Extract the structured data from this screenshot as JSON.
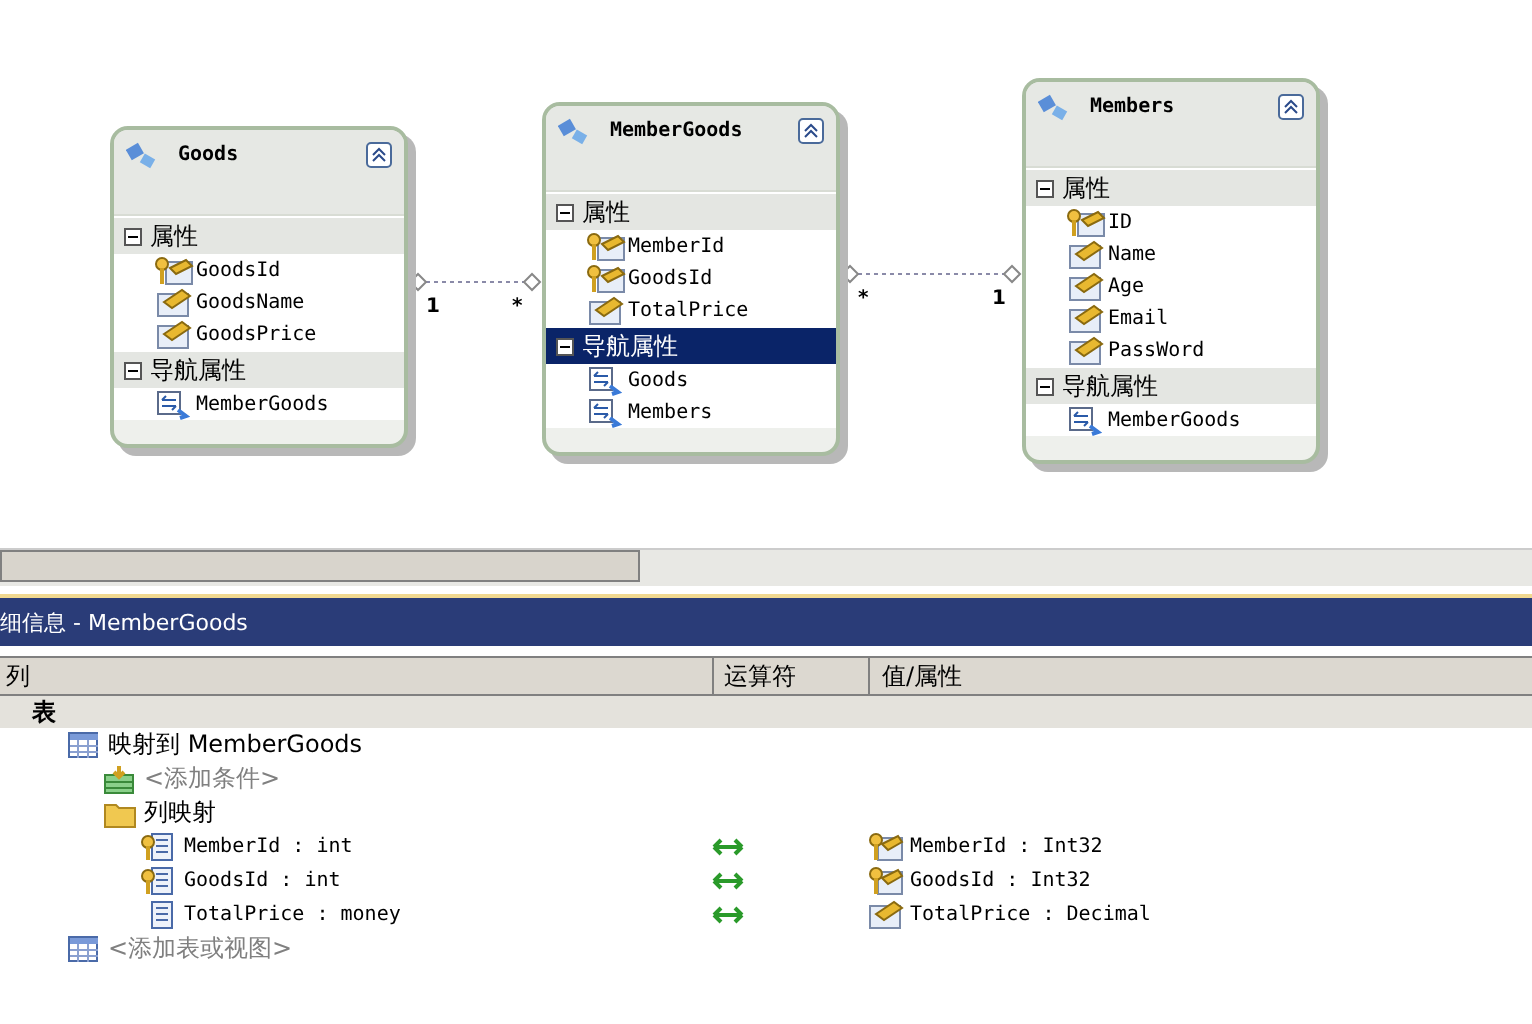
{
  "entities": [
    {
      "name": "Goods",
      "sections": [
        {
          "label": "属性",
          "expanded": true,
          "selected": false,
          "items": [
            {
              "name": "GoodsId",
              "kind": "key"
            },
            {
              "name": "GoodsName",
              "kind": "property"
            },
            {
              "name": "GoodsPrice",
              "kind": "property"
            }
          ]
        },
        {
          "label": "导航属性",
          "expanded": true,
          "selected": false,
          "items": [
            {
              "name": "MemberGoods",
              "kind": "navigation"
            }
          ]
        }
      ]
    },
    {
      "name": "MemberGoods",
      "sections": [
        {
          "label": "属性",
          "expanded": true,
          "selected": false,
          "items": [
            {
              "name": "MemberId",
              "kind": "key"
            },
            {
              "name": "GoodsId",
              "kind": "key"
            },
            {
              "name": "TotalPrice",
              "kind": "property"
            }
          ]
        },
        {
          "label": "导航属性",
          "expanded": true,
          "selected": true,
          "items": [
            {
              "name": "Goods",
              "kind": "navigation"
            },
            {
              "name": "Members",
              "kind": "navigation"
            }
          ]
        }
      ]
    },
    {
      "name": "Members",
      "sections": [
        {
          "label": "属性",
          "expanded": true,
          "selected": false,
          "items": [
            {
              "name": "ID",
              "kind": "key"
            },
            {
              "name": "Name",
              "kind": "property"
            },
            {
              "name": "Age",
              "kind": "property"
            },
            {
              "name": "Email",
              "kind": "property"
            },
            {
              "name": "PassWord",
              "kind": "property"
            }
          ]
        },
        {
          "label": "导航属性",
          "expanded": true,
          "selected": false,
          "items": [
            {
              "name": "MemberGoods",
              "kind": "navigation"
            }
          ]
        }
      ]
    }
  ],
  "associations": [
    {
      "source_multiplicity": "1",
      "target_multiplicity": "*"
    },
    {
      "source_multiplicity": "*",
      "target_multiplicity": "1"
    }
  ],
  "details_panel": {
    "title": "细信息 - MemberGoods",
    "columns": [
      "列",
      "运算符",
      "值/属性"
    ],
    "tree": [
      {
        "kind": "section",
        "label": "表",
        "children": [
          {
            "kind": "table",
            "label": "映射到 MemberGoods",
            "children": [
              {
                "kind": "condition",
                "label": "<添加条件>"
              },
              {
                "kind": "folder",
                "label": "列映射",
                "children": [
                  {
                    "kind": "mapping",
                    "column": "MemberId : int",
                    "column_key": true,
                    "property": "MemberId : Int32",
                    "property_key": true
                  },
                  {
                    "kind": "mapping",
                    "column": "GoodsId : int",
                    "column_key": true,
                    "property": "GoodsId : Int32",
                    "property_key": true
                  },
                  {
                    "kind": "mapping",
                    "column": "TotalPrice : money",
                    "column_key": false,
                    "property": "TotalPrice : Decimal",
                    "property_key": false
                  }
                ]
              }
            ]
          },
          {
            "kind": "add_table",
            "label": "<添加表或视图>"
          }
        ]
      }
    ]
  }
}
